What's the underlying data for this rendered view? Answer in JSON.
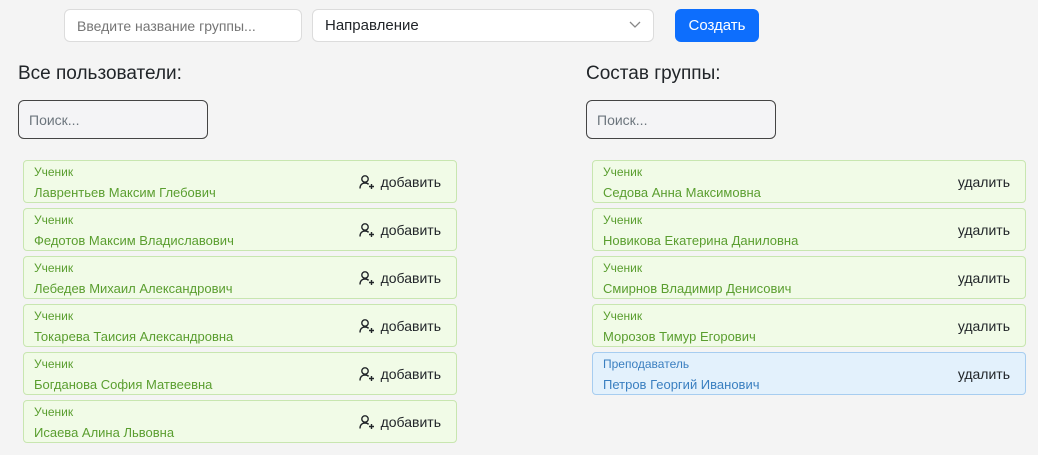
{
  "header": {
    "group_name_placeholder": "Введите название группы...",
    "direction_value": "Направление",
    "create_label": "Создать"
  },
  "all_users": {
    "title": "Все пользователи:",
    "search_placeholder": "Поиск...",
    "action_label": "добавить",
    "items": [
      {
        "role": "Ученик",
        "name": "Лаврентьев Максим Глебович"
      },
      {
        "role": "Ученик",
        "name": "Федотов Максим Владиславович"
      },
      {
        "role": "Ученик",
        "name": "Лебедев Михаил Александрович"
      },
      {
        "role": "Ученик",
        "name": "Токарева Таисия Александровна"
      },
      {
        "role": "Ученик",
        "name": "Богданова София Матвеевна"
      },
      {
        "role": "Ученик",
        "name": "Исаева Алина Львовна"
      }
    ]
  },
  "group": {
    "title": "Состав группы:",
    "search_placeholder": "Поиск...",
    "action_label": "удалить",
    "items": [
      {
        "role": "Ученик",
        "name": "Седова Анна Максимовна"
      },
      {
        "role": "Ученик",
        "name": "Новикова Екатерина Даниловна"
      },
      {
        "role": "Ученик",
        "name": "Смирнов Владимир Денисович"
      },
      {
        "role": "Ученик",
        "name": "Морозов Тимур Егорович"
      },
      {
        "role": "Преподаватель",
        "name": "Петров Георгий Иванович"
      }
    ]
  },
  "colors": {
    "primary": "#0d6efd",
    "student_text": "#5a9e2f",
    "student_bg": "#f1fbe7",
    "teacher_text": "#3a7fc0",
    "teacher_bg": "#e3f1fc"
  },
  "icons": {
    "add": "user-plus-icon",
    "select": "chevron-down-icon"
  }
}
